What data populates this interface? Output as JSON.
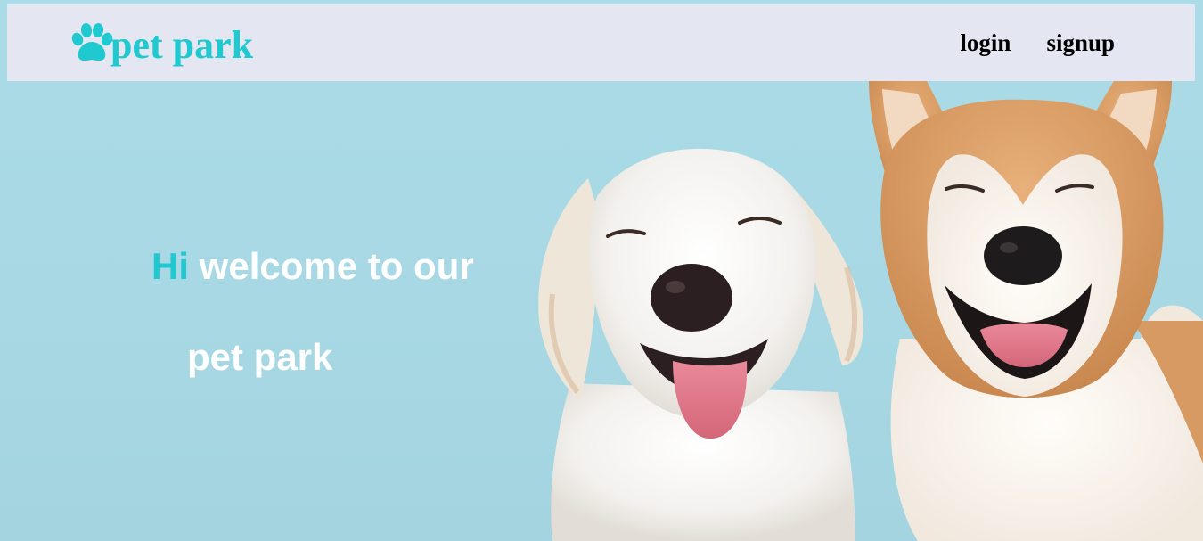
{
  "header": {
    "brand_name": "pet park",
    "brand_icon": "paw-icon",
    "nav": [
      {
        "label": "login"
      },
      {
        "label": "signup"
      }
    ]
  },
  "hero": {
    "greeting": "Hi",
    "line1_rest": " welcome to our",
    "line2": "pet park",
    "image": "two-smiling-dogs-photo"
  },
  "colors": {
    "accent": "#20c9cf",
    "navbar_bg": "#e4e7f2",
    "hero_bg": "#aadbe7",
    "hero_text": "#ffffff",
    "nav_text": "#000000"
  }
}
